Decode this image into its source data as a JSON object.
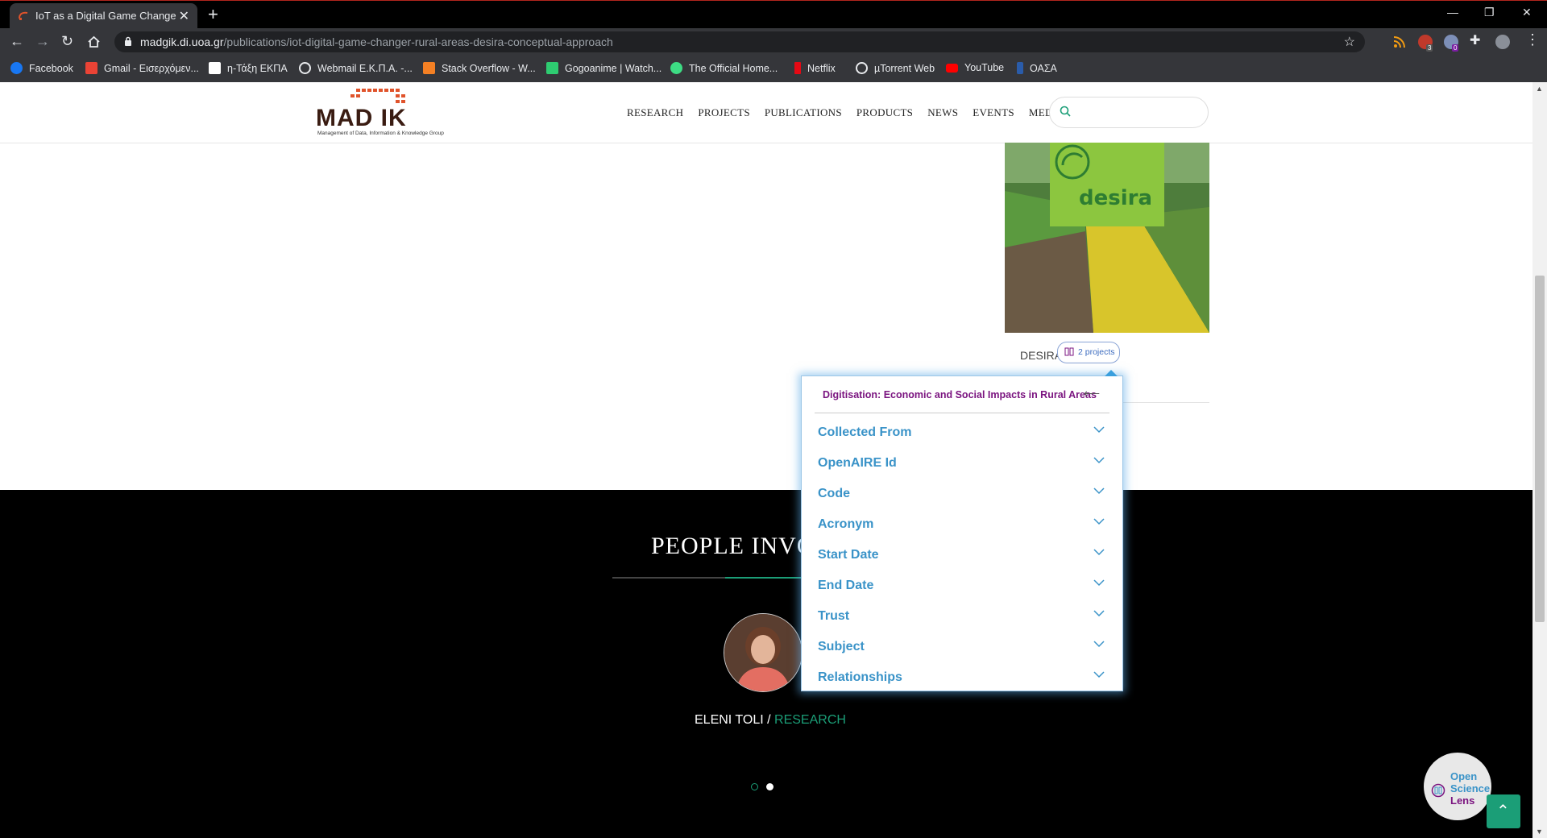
{
  "browser": {
    "tab_title": "IoT as a Digital Game Changer in",
    "url_host": "madgik.di.uoa.gr",
    "url_path": "/publications/iot-digital-game-changer-rural-areas-desira-conceptual-approach",
    "extension_badges": [
      "3",
      "0"
    ]
  },
  "bookmarks": [
    {
      "label": "Facebook",
      "icon": "facebook-icon",
      "color": "#1877f2"
    },
    {
      "label": "Gmail - Εισερχόμεν...",
      "icon": "gmail-icon",
      "color": "#ea4335"
    },
    {
      "label": "η-Τάξη ΕΚΠΑ",
      "icon": "eclass-icon",
      "color": "#ffffff"
    },
    {
      "label": "Webmail Ε.Κ.Π.Α. -...",
      "icon": "globe-icon",
      "color": "#e8eaed"
    },
    {
      "label": "Stack Overflow - W...",
      "icon": "stackoverflow-icon",
      "color": "#f48024"
    },
    {
      "label": "Gogoanime | Watch...",
      "icon": "gogoanime-icon",
      "color": "#2ecc71"
    },
    {
      "label": "The Official Home...",
      "icon": "official-home-icon",
      "color": "#3ddc84"
    },
    {
      "label": "Netflix",
      "icon": "netflix-icon",
      "color": "#e50914"
    },
    {
      "label": "µTorrent Web",
      "icon": "globe-icon",
      "color": "#e8eaed"
    },
    {
      "label": "YouTube",
      "icon": "youtube-icon",
      "color": "#ff0000"
    },
    {
      "label": "ΟΑΣΑ",
      "icon": "oasa-icon",
      "color": "#2a5caa"
    }
  ],
  "site": {
    "logo_text": "MAD IK",
    "logo_sub": "Management of Data, Information & Knowledge Group",
    "nav": [
      "RESEARCH",
      "PROJECTS",
      "PUBLICATIONS",
      "PRODUCTS",
      "NEWS",
      "EVENTS",
      "MEDIA"
    ],
    "accent": "#1b9e77"
  },
  "project": {
    "image_logo": "desira",
    "caption": "DESIRA",
    "badge": "2 projects"
  },
  "popup": {
    "title": "Digitisation: Economic and Social Impacts in Rural Areas",
    "rows": [
      "Collected From",
      "OpenAIRE Id",
      "Code",
      "Acronym",
      "Start Date",
      "End Date",
      "Trust",
      "Subject",
      "Relationships"
    ]
  },
  "people": {
    "title": "PEOPLE INVO",
    "name": "ELENI TOLI",
    "sep": " / ",
    "role": "RESEARCH",
    "carousel_active": 0,
    "carousel_count": 2
  },
  "widget": {
    "line1": "Open",
    "line2": "Science",
    "line3": "Lens"
  }
}
